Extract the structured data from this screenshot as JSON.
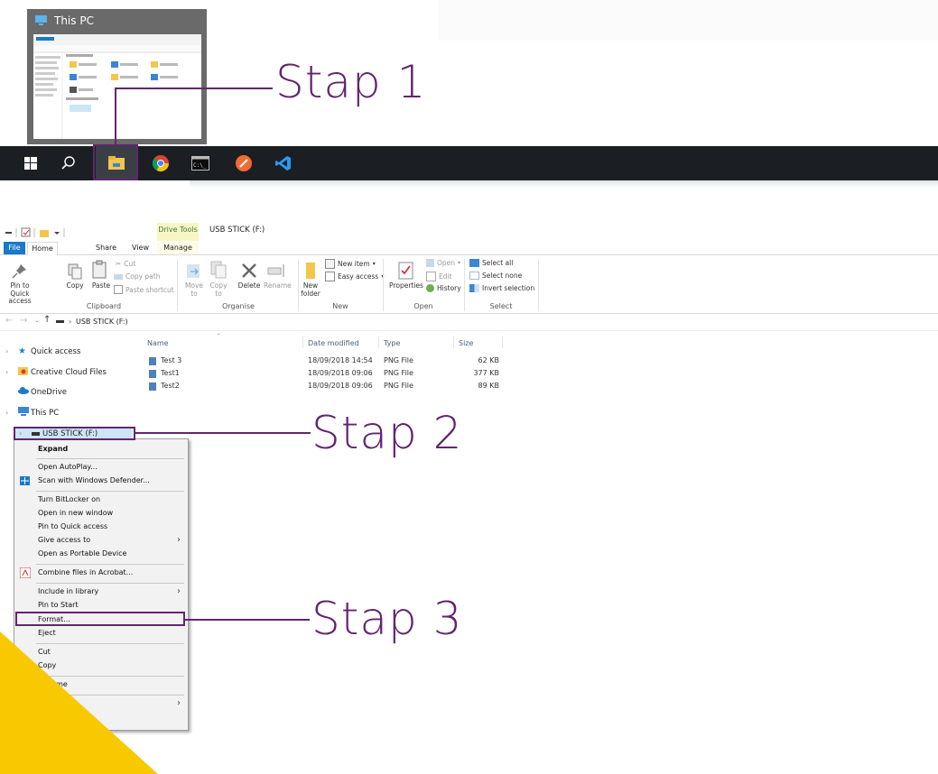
{
  "steps": [
    "Stap 1",
    "Stap 2",
    "Stap 3"
  ],
  "thumbnail": {
    "title": "This PC"
  },
  "taskbar": {
    "icons": [
      "windows-start-icon",
      "search-icon",
      "file-explorer-icon",
      "chrome-icon",
      "terminal-icon",
      "pen-app-icon",
      "vscode-icon"
    ]
  },
  "explorer": {
    "context_tab": "Drive Tools",
    "window_title": "USB STICK (F:)",
    "tabs": [
      "File",
      "Home",
      "Share",
      "View",
      "Manage"
    ],
    "ribbon": {
      "clipboard": {
        "pin": "Pin to Quick access",
        "copy": "Copy",
        "paste": "Paste",
        "cut": "Cut",
        "copy_path": "Copy path",
        "paste_shortcut": "Paste shortcut",
        "label": "Clipboard"
      },
      "organise": {
        "move_to": "Move to",
        "copy_to": "Copy to",
        "delete": "Delete",
        "rename": "Rename",
        "label": "Organise"
      },
      "new": {
        "new_folder": "New folder",
        "new_item": "New item",
        "easy_access": "Easy access",
        "label": "New"
      },
      "open": {
        "properties": "Properties",
        "open": "Open",
        "edit": "Edit",
        "history": "History",
        "label": "Open"
      },
      "select": {
        "select_all": "Select all",
        "select_none": "Select none",
        "invert": "Invert selection",
        "label": "Select"
      }
    },
    "address": {
      "path": "USB STICK (F:)"
    },
    "nav": {
      "quick_access": "Quick access",
      "creative_cloud": "Creative Cloud Files",
      "onedrive": "OneDrive",
      "this_pc": "This PC",
      "usb": "USB STICK (F:)"
    },
    "columns": [
      "Name",
      "Date modified",
      "Type",
      "Size"
    ],
    "files": [
      {
        "name": "Test 3",
        "date": "18/09/2018 14:54",
        "type": "PNG File",
        "size": "62 KB"
      },
      {
        "name": "Test1",
        "date": "18/09/2018 09:06",
        "type": "PNG File",
        "size": "377 KB"
      },
      {
        "name": "Test2",
        "date": "18/09/2018 09:06",
        "type": "PNG File",
        "size": "89 KB"
      }
    ]
  },
  "context_menu": {
    "expand": "Expand",
    "open_autoplay": "Open AutoPlay...",
    "scan_defender": "Scan with Windows Defender...",
    "bitlocker": "Turn BitLocker on",
    "open_new_window": "Open in new window",
    "pin_quick": "Pin to Quick access",
    "give_access": "Give access to",
    "open_portable": "Open as Portable Device",
    "combine_acrobat": "Combine files in Acrobat...",
    "include_library": "Include in library",
    "pin_start": "Pin to Start",
    "format": "Format...",
    "eject": "Eject",
    "cut": "Cut",
    "copy": "Copy",
    "rename": "Rename"
  },
  "colors": {
    "accent": "#62256f",
    "corner": "#f8c900",
    "taskbar": "#1b1f24",
    "file_tab": "#1979ca"
  }
}
